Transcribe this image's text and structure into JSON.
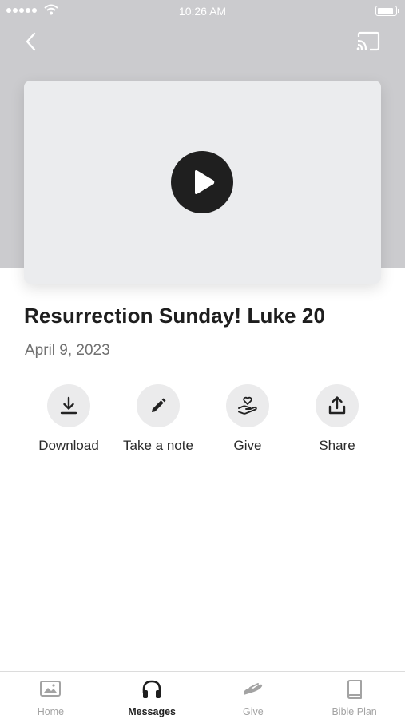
{
  "status_bar": {
    "time": "10:26 AM"
  },
  "sermon": {
    "title": "Resurrection Sunday! Luke 20",
    "date": "April 9, 2023"
  },
  "actions": [
    {
      "label": "Download",
      "icon": "download-icon"
    },
    {
      "label": "Take a note",
      "icon": "pencil-icon"
    },
    {
      "label": "Give",
      "icon": "hand-heart-icon"
    },
    {
      "label": "Share",
      "icon": "share-icon"
    }
  ],
  "tabs": [
    {
      "label": "Home",
      "icon": "image-icon",
      "active": false
    },
    {
      "label": "Messages",
      "icon": "headphones-icon",
      "active": true
    },
    {
      "label": "Give",
      "icon": "giving-hand-icon",
      "active": false
    },
    {
      "label": "Bible Plan",
      "icon": "book-icon",
      "active": false
    }
  ],
  "colors": {
    "hero_bg": "#cbcbce",
    "card": "#ebecee",
    "play": "#1f1f1f",
    "tab_inactive": "#a3a3a3"
  }
}
